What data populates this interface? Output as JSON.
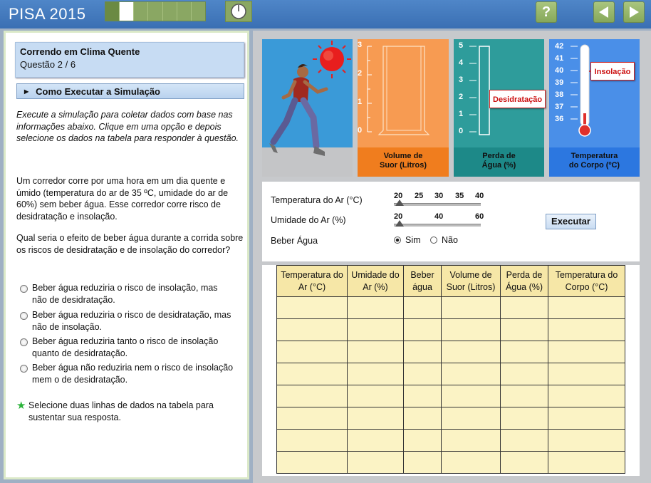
{
  "app": {
    "title": "PISA 2015"
  },
  "progress": {
    "total_segments": 7,
    "done_segments": 1,
    "current_segment": 2
  },
  "nav": {
    "help_label": "?",
    "prev_icon": "left-arrow-icon",
    "next_icon": "right-arrow-icon"
  },
  "unit": {
    "title": "Correndo em Clima Quente",
    "question": "Questão 2 / 6"
  },
  "howto": {
    "label": "Como Executar a Simulação"
  },
  "instructions": "Execute a simulação para coletar dados com base nas informações abaixo. Clique em uma opção e depois selecione os dados na tabela para responder à questão.",
  "scenario": "Um corredor corre por uma hora em um dia quente e úmido (temperatura do ar de 35 ºC, umidade do ar de 60%) sem beber água. Esse corredor corre risco de desidratação e insolação.",
  "prompt": "Qual seria o efeito de beber água durante a corrida sobre os riscos de desidratação e de insolação do corredor?",
  "options": [
    "Beber água reduziria o risco de insolação, mas não de desidratação.",
    "Beber água reduziria o risco de desidratação, mas não de insolação.",
    "Beber água reduziria tanto o risco de insolação quanto de desidratação.",
    "Beber água não reduziria nem o risco de insolação mem o de desidratação."
  ],
  "hint": "Selecione duas linhas de dados na tabela para sustentar sua resposta.",
  "gauges": {
    "sweat": {
      "label_line1": "Volume de",
      "label_line2": "Suor (Litros)",
      "ticks": [
        "3",
        "2",
        "1",
        "0"
      ]
    },
    "dehydration": {
      "label_line1": "Perda de",
      "label_line2": "Água (%)",
      "ticks": [
        "5",
        "4",
        "3",
        "2",
        "1",
        "0"
      ],
      "callout": "Desidratação"
    },
    "body_temp": {
      "label_line1": "Temperatura",
      "label_line2": "do Corpo (ºC)",
      "ticks": [
        "42",
        "41",
        "40",
        "39",
        "38",
        "37",
        "36"
      ],
      "callout": "Insolação"
    }
  },
  "controls": {
    "air_temp": {
      "label": "Temperatura do Ar (°C)",
      "ticks": [
        "20",
        "25",
        "30",
        "35",
        "40"
      ],
      "value": 20
    },
    "humidity": {
      "label": "Umidade do Ar (%)",
      "ticks": [
        "20",
        "40",
        "60"
      ],
      "value": 20
    },
    "water": {
      "label": "Beber Água",
      "yes": "Sim",
      "no": "Não",
      "selected": "Sim"
    },
    "run_label": "Executar"
  },
  "table": {
    "headers": [
      [
        "Temperatura do",
        "Ar (°C)"
      ],
      [
        "Umidade do",
        "Ar (%)"
      ],
      [
        "Beber",
        "água"
      ],
      [
        "Volume de",
        "Suor (Litros)"
      ],
      [
        "Perda de",
        "Água (%)"
      ],
      [
        "Temperatura do",
        "Corpo (°C)"
      ]
    ],
    "empty_rows": 8
  },
  "colors": {
    "topbar": "#3a6fb3",
    "sky": "#3a9ad8",
    "sweat": "#f07d1e",
    "dehydration": "#1d8988",
    "body_temp": "#2c77e0",
    "callout_text": "#cc1111",
    "table_cell": "#fbf3c5"
  }
}
